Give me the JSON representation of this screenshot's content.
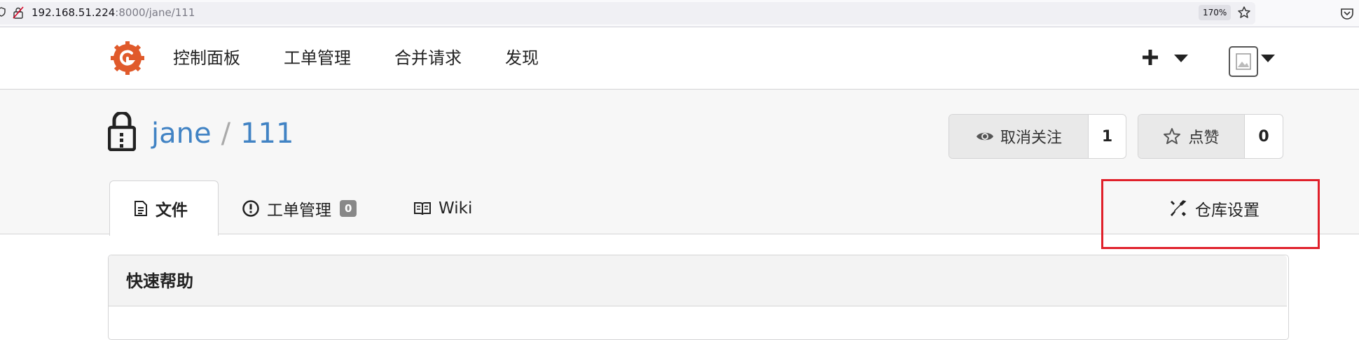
{
  "browser": {
    "url_host": "192.168.51.224",
    "url_rest": ":8000/jane/111",
    "zoom": "170%"
  },
  "nav": {
    "items": [
      {
        "label": "控制面板"
      },
      {
        "label": "工单管理"
      },
      {
        "label": "合并请求"
      },
      {
        "label": "发现"
      }
    ]
  },
  "repo": {
    "owner": "jane",
    "separator": "/",
    "name": "111",
    "watch_label": "取消关注",
    "watch_count": "1",
    "star_label": "点赞",
    "star_count": "0"
  },
  "tabs": {
    "files": "文件",
    "issues": "工单管理",
    "issues_count": "0",
    "wiki": "Wiki",
    "settings": "仓库设置"
  },
  "panel": {
    "title": "快速帮助"
  },
  "colors": {
    "link": "#4183c4",
    "logo": "#e05a2b",
    "highlight": "#e0202a"
  }
}
